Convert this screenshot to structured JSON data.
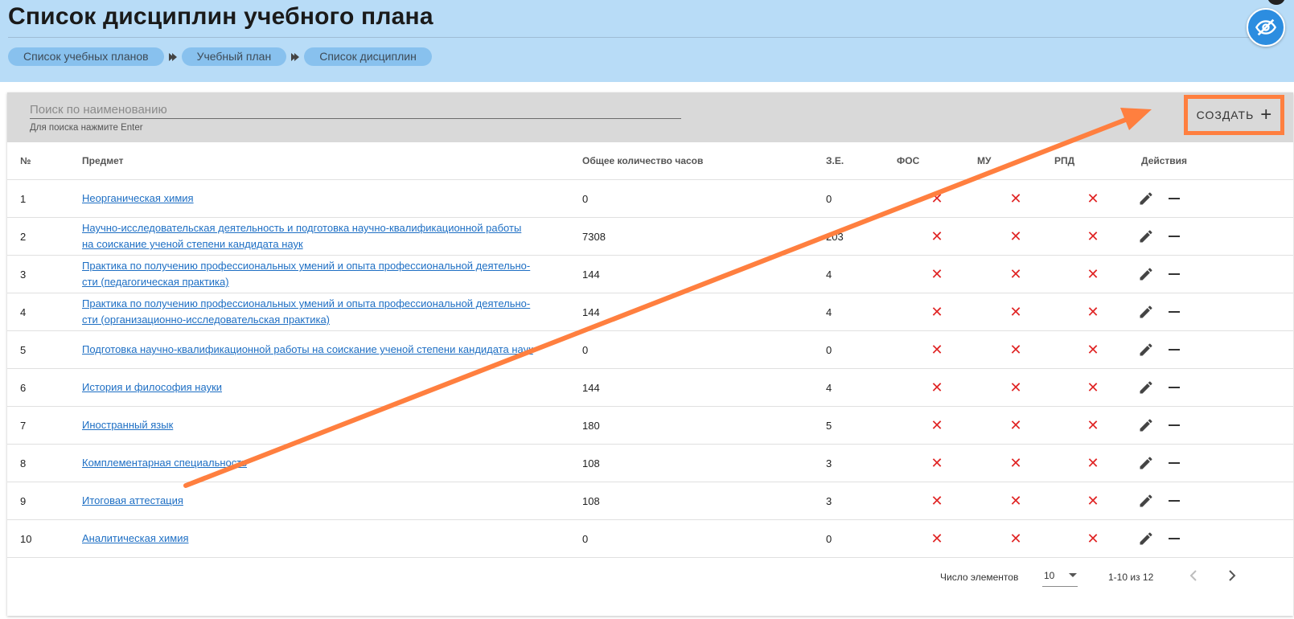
{
  "header": {
    "title": "Список дисциплин учебного плана",
    "breadcrumbs": [
      "Список учебных планов",
      "Учебный план",
      "Список дисциплин"
    ],
    "visibility_icon": "eye-off-icon",
    "background_color": "#b8dcf7"
  },
  "toolbar": {
    "search_placeholder": "Поиск по наименованию",
    "search_value": "",
    "search_hint": "Для поиска нажмите Enter",
    "create_label": "СОЗДАТЬ",
    "create_icon": "plus-icon"
  },
  "table": {
    "columns": [
      "№",
      "Предмет",
      "Общее количество часов",
      "З.Е.",
      "ФОС",
      "МУ",
      "РПД",
      "Действия"
    ],
    "rows": [
      {
        "num": "1",
        "subject": [
          "Неорганическая химия"
        ],
        "hours": "0",
        "ze": "0"
      },
      {
        "num": "2",
        "subject": [
          "Научно-исследовательская деятельность и подготовка научно-квалификационной работы",
          "на соискание ученой степени кандидата наук"
        ],
        "hours": "7308",
        "ze": "203"
      },
      {
        "num": "3",
        "subject": [
          "Практика по получению профессиональных умений и опыта профессиональной деятельно-",
          "сти (педагогическая практика)"
        ],
        "hours": "144",
        "ze": "4"
      },
      {
        "num": "4",
        "subject": [
          "Практика по получению профессиональных умений и опыта профессиональной деятельно-",
          "сти (организационно-исследовательская практика)"
        ],
        "hours": "144",
        "ze": "4"
      },
      {
        "num": "5",
        "subject": [
          "Подготовка научно-квалификационной работы на соискание ученой степени кандидата наук"
        ],
        "hours": "0",
        "ze": "0"
      },
      {
        "num": "6",
        "subject": [
          "История и философия науки"
        ],
        "hours": "144",
        "ze": "4"
      },
      {
        "num": "7",
        "subject": [
          "Иностранный язык"
        ],
        "hours": "180",
        "ze": "5"
      },
      {
        "num": "8",
        "subject": [
          "Комплементарная специальность"
        ],
        "hours": "108",
        "ze": "3"
      },
      {
        "num": "9",
        "subject": [
          "Итоговая аттестация"
        ],
        "hours": "108",
        "ze": "3"
      },
      {
        "num": "10",
        "subject": [
          "Аналитическая химия"
        ],
        "hours": "0",
        "ze": "0"
      }
    ],
    "status_mark": "✕",
    "status_color": "#e02424",
    "row_actions": [
      "edit-icon",
      "minus-icon"
    ]
  },
  "paginator": {
    "items_label": "Число элементов",
    "page_size": "10",
    "range_label": "1-10 из 12",
    "prev_icon": "chevron-left-icon",
    "next_icon": "chevron-right-icon"
  },
  "annotation": {
    "arrow_color": "#ff7f3f",
    "highlight": "create-button"
  }
}
